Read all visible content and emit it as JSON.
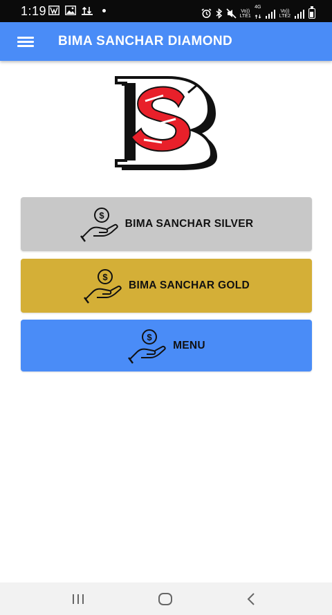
{
  "status_bar": {
    "time": "1:19",
    "volte1_top": "Vo))",
    "volte1_bottom": "LTE1",
    "network_4g": "4G",
    "volte2_top": "Vo))",
    "volte2_bottom": "LTE2"
  },
  "app_bar": {
    "title": "BIMA SANCHAR DIAMOND",
    "color": "#4a8cf7"
  },
  "buttons": [
    {
      "label": "BIMA SANCHAR SILVER",
      "color": "#c8c8c8",
      "icon": "money-hand-icon"
    },
    {
      "label": "BIMA SANCHAR GOLD",
      "color": "#d4af37",
      "icon": "money-hand-icon"
    },
    {
      "label": "MENU",
      "color": "#4a8cf7",
      "icon": "money-hand-icon"
    }
  ],
  "logo": {
    "icon": "bs-logo",
    "accent": "#e8202a"
  }
}
